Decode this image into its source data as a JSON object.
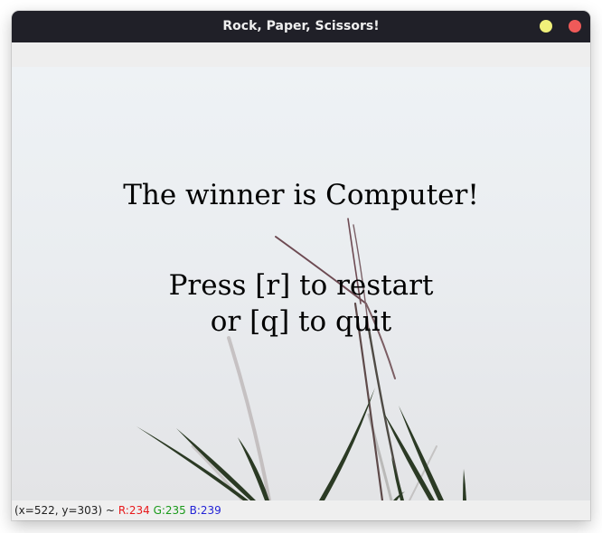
{
  "window": {
    "title": "Rock, Paper, Scissors!",
    "controls": {
      "minimize_color": "#f0f07a",
      "close_color": "#ef5a59"
    }
  },
  "canvas": {
    "winner_text": "The winner is Computer!",
    "prompt_line1": "Press [r] to restart",
    "prompt_line2": "or [q] to quit",
    "background": "grass stems on pale grey-blue sky"
  },
  "status": {
    "coords": "(x=522, y=303) ~",
    "r_label": "R:234",
    "g_label": "G:235",
    "b_label": "B:239",
    "r_color": "#e8191b",
    "g_color": "#1a9a1a",
    "b_color": "#2323d6"
  }
}
